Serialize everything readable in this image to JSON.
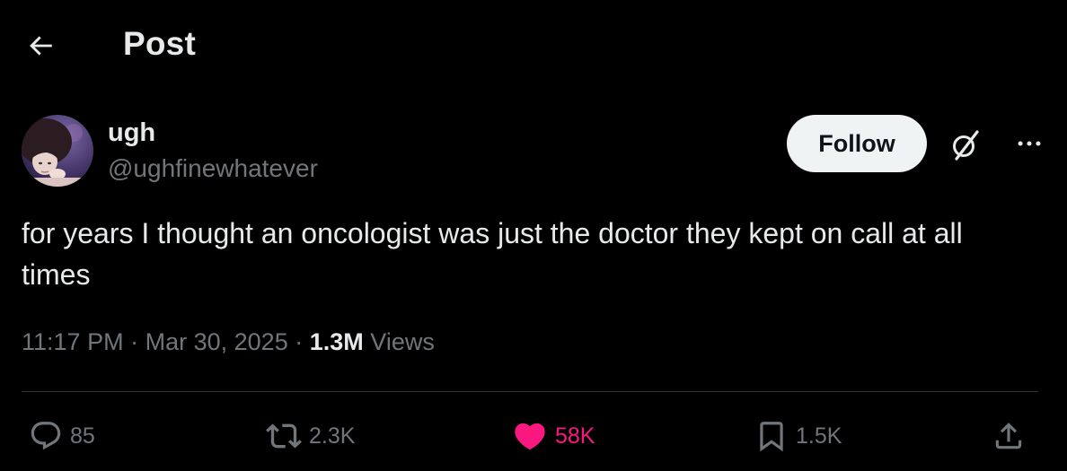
{
  "header": {
    "title": "Post",
    "back_icon": "arrow-left-icon"
  },
  "author": {
    "display_name": "ugh",
    "handle": "@ughfinewhatever",
    "avatar_icon": "avatar"
  },
  "buttons": {
    "follow_label": "Follow",
    "grok_icon": "grok-icon",
    "more_icon": "more-icon"
  },
  "post": {
    "text": "for years I thought an oncologist was just the doctor they kept on call at all times",
    "time": "11:17 PM",
    "date": "Mar 30, 2025",
    "separator": "·",
    "views_count": "1.3M",
    "views_label": "Views"
  },
  "actions": {
    "replies": "85",
    "reposts": "2.3K",
    "likes": "58K",
    "bookmarks": "1.5K",
    "reply_icon": "reply-icon",
    "repost_icon": "repost-icon",
    "like_icon": "heart-icon",
    "bookmark_icon": "bookmark-icon",
    "share_icon": "share-icon"
  },
  "colors": {
    "background": "#000000",
    "primary_text": "#e7e9ea",
    "secondary_text": "#71767b",
    "like_pink": "#f91880",
    "divider": "#2f3336",
    "follow_bg": "#eff3f4"
  }
}
